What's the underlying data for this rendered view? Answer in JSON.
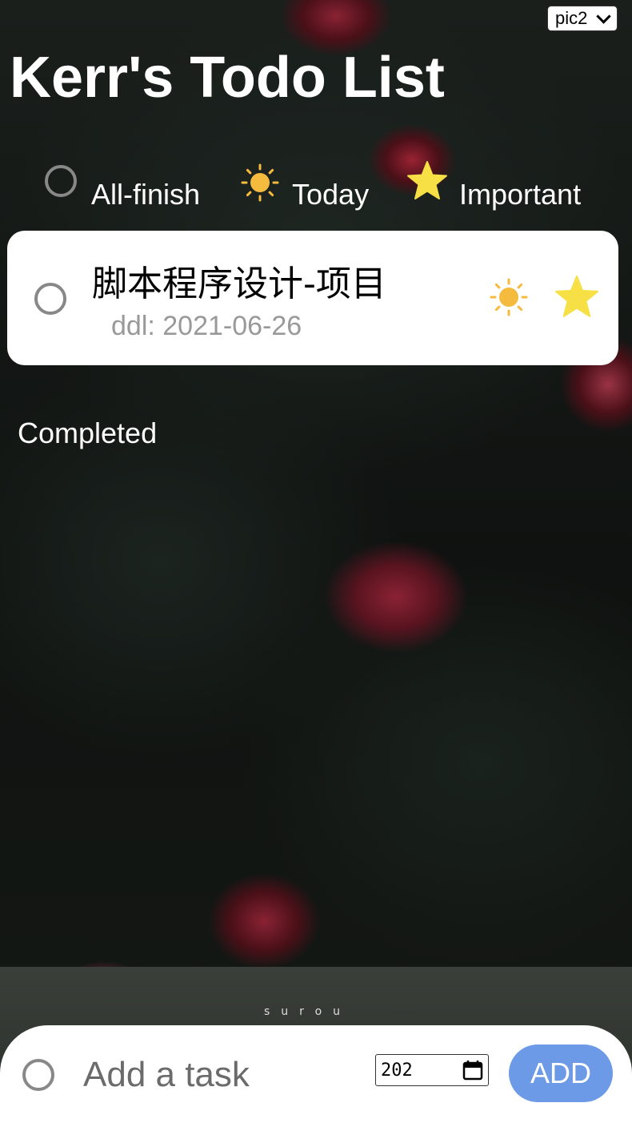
{
  "theme_select": {
    "value": "pic2"
  },
  "header": {
    "title": "Kerr's Todo List"
  },
  "filters": {
    "all_finish": "All-finish",
    "today": "Today",
    "important": "Important"
  },
  "tasks": [
    {
      "title": "脚本程序设计-项目",
      "ddl": "ddl: 2021-06-26",
      "today": true,
      "important": true
    }
  ],
  "completed": {
    "label": "Completed"
  },
  "add_bar": {
    "placeholder": "Add a task",
    "date_value": "202",
    "add_label": "ADD"
  },
  "background": {
    "watermark": "surou"
  },
  "colors": {
    "sun": "#F5BB3E",
    "star": "#F7E046",
    "add_button": "#6D9AE6",
    "ring": "#888888"
  },
  "icons": {
    "sun": "sun-icon",
    "star": "star-icon",
    "ring": "circle-checkbox-icon",
    "calendar": "calendar-icon",
    "chevron": "chevron-down-icon"
  }
}
